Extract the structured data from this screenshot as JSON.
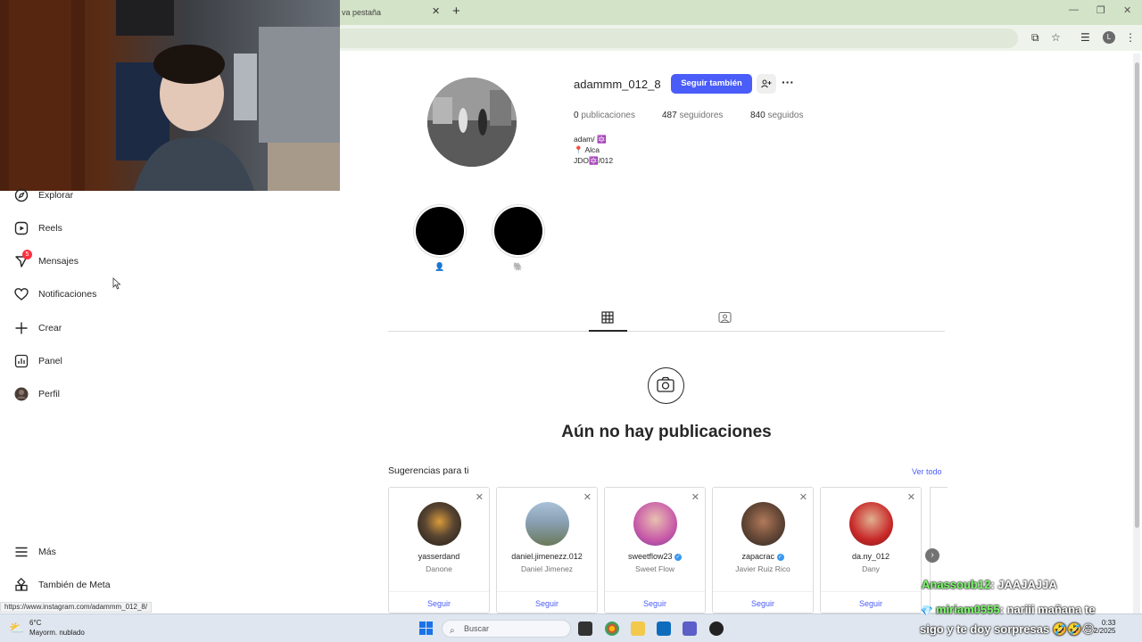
{
  "browser": {
    "tab_title": "va pestaña",
    "tab_close": "✕",
    "new_tab": "+",
    "profile_initial": "L"
  },
  "sidebar": {
    "items": [
      {
        "label": "Explorar",
        "icon": "compass-icon"
      },
      {
        "label": "Reels",
        "icon": "reels-icon"
      },
      {
        "label": "Mensajes",
        "icon": "messenger-icon",
        "badge": "5"
      },
      {
        "label": "Notificaciones",
        "icon": "heart-icon"
      },
      {
        "label": "Crear",
        "icon": "plus-icon"
      },
      {
        "label": "Panel",
        "icon": "chart-icon"
      },
      {
        "label": "Perfil",
        "icon": "avatar"
      }
    ],
    "more_label": "Más",
    "meta_label": "También de Meta",
    "status_url": "https://www.instagram.com/adammm_012_8/"
  },
  "profile": {
    "username": "adammm_012_8",
    "follow_button": "Seguir también",
    "stats": {
      "posts_count": "0",
      "posts_label": "publicaciones",
      "followers_count": "487",
      "followers_label": "seguidores",
      "following_count": "840",
      "following_label": "seguidos"
    },
    "bio": [
      "adam/ 🔯",
      "📍 Alca",
      "JDO🔯/012"
    ],
    "highlights": [
      {
        "label": "👤"
      },
      {
        "label": "🐘"
      }
    ]
  },
  "empty_state": {
    "title": "Aún no hay publicaciones"
  },
  "suggestions": {
    "title": "Sugerencias para ti",
    "see_all": "Ver todo",
    "follow_label": "Seguir",
    "cards": [
      {
        "username": "yasserdand",
        "name": "Danone",
        "verified": false,
        "color": "#5a4632"
      },
      {
        "username": "daniel.jimenezz.012",
        "name": "Daniel Jimenez",
        "verified": false,
        "color": "#8aa0b4"
      },
      {
        "username": "sweetflow23",
        "name": "Sweet Flow",
        "verified": true,
        "color": "#c85aa8"
      },
      {
        "username": "zapacrac",
        "name": "Javier Ruiz Rico",
        "verified": true,
        "color": "#6a4a38"
      },
      {
        "username": "da.ny_012",
        "name": "Dany",
        "verified": false,
        "color": "#c82828"
      }
    ]
  },
  "taskbar": {
    "temperature": "6°C",
    "weather": "Mayorm. nublado",
    "search_placeholder": "Buscar",
    "time": "0:33",
    "date": "2/2025"
  },
  "chat": [
    {
      "user": "Anassoub12",
      "text": ": JAAJAJJA"
    },
    {
      "user": "miriam0555",
      "text": ": nariii mañana te"
    },
    {
      "user": "",
      "text": "sigo y te doy sorpresas 🤣🤣😂"
    }
  ],
  "colors": {
    "accent": "#4a5df9",
    "badge": "#ff3040",
    "chat_user": "#7cff6b"
  }
}
